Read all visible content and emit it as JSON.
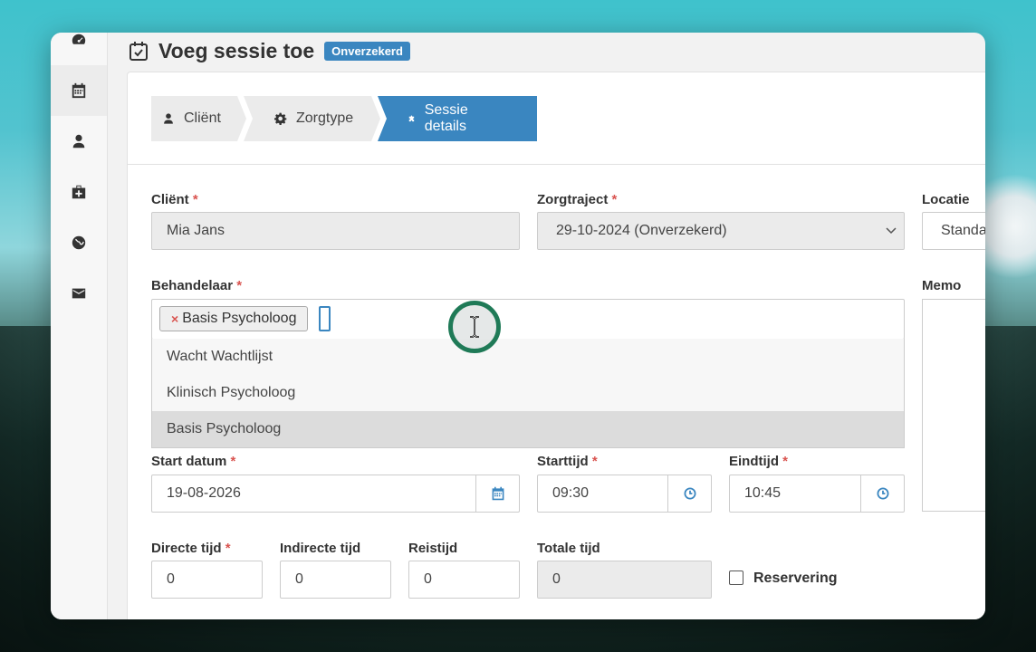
{
  "header": {
    "title": "Voeg sessie toe",
    "badge": "Onverzekerd"
  },
  "sidebar": {
    "items": [
      {
        "icon": "dashboard-icon"
      },
      {
        "icon": "calendar-icon",
        "active": true
      },
      {
        "icon": "user-icon"
      },
      {
        "icon": "medkit-icon"
      },
      {
        "icon": "globe-icon"
      },
      {
        "icon": "envelope-icon"
      }
    ]
  },
  "steps": [
    {
      "label": "Cliënt",
      "icon": "user-icon"
    },
    {
      "label": "Zorgtype",
      "icon": "gear-icon"
    },
    {
      "label": "Sessie details",
      "icon": "puzzle-icon",
      "active": true
    }
  ],
  "form": {
    "client": {
      "label": "Cliënt",
      "value": "Mia Jans"
    },
    "zorgtraject": {
      "label": "Zorgtraject",
      "value": "29-10-2024 (Onverzekerd)"
    },
    "locatie": {
      "label": "Locatie",
      "value": "Standa"
    },
    "behandelaar": {
      "label": "Behandelaar",
      "tag": "Basis Psycholoog",
      "tag_remove": "×",
      "options": [
        "Wacht Wachtlijst",
        "Klinisch Psycholoog",
        "Basis Psycholoog"
      ]
    },
    "memo": {
      "label": "Memo"
    },
    "start_datum": {
      "label": "Start datum",
      "value": "19-08-2026"
    },
    "starttijd": {
      "label": "Starttijd",
      "value": "09:30"
    },
    "eindtijd": {
      "label": "Eindtijd",
      "value": "10:45"
    },
    "directe_tijd": {
      "label": "Directe tijd",
      "value": "0"
    },
    "indirecte_tijd": {
      "label": "Indirecte tijd",
      "value": "0"
    },
    "reistijd": {
      "label": "Reistijd",
      "value": "0"
    },
    "totale_tijd": {
      "label": "Totale tijd",
      "value": "0"
    },
    "reservering": {
      "label": "Reservering",
      "checked": false
    },
    "required_mark": "*"
  },
  "colors": {
    "accent": "#3a86c0",
    "required": "#d9534f",
    "cursor_ring": "#1f7a57"
  }
}
